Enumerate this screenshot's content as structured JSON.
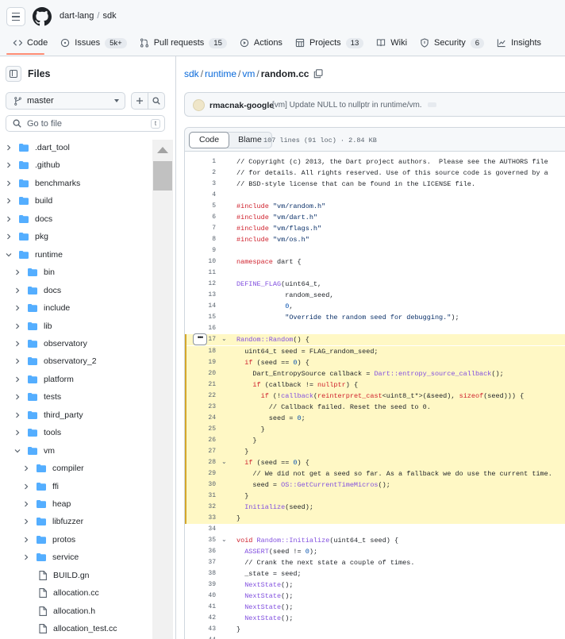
{
  "header": {
    "owner": "dart-lang",
    "separator": "/",
    "repo": "sdk",
    "tabs": [
      {
        "label": "Code",
        "count": "",
        "icon": "code-icon"
      },
      {
        "label": "Issues",
        "count": "5k+",
        "icon": "issue-icon"
      },
      {
        "label": "Pull requests",
        "count": "15",
        "icon": "pull-request-icon"
      },
      {
        "label": "Actions",
        "count": "",
        "icon": "play-icon"
      },
      {
        "label": "Projects",
        "count": "13",
        "icon": "table-icon"
      },
      {
        "label": "Wiki",
        "count": "",
        "icon": "book-icon"
      },
      {
        "label": "Security",
        "count": "6",
        "icon": "shield-icon"
      },
      {
        "label": "Insights",
        "count": "",
        "icon": "graph-icon"
      }
    ]
  },
  "sidebar": {
    "title": "Files",
    "branch": "master",
    "search_placeholder": "Go to file",
    "search_shortcut": "t",
    "tree": [
      {
        "name": ".dart_tool",
        "type": "dir",
        "depth": 0,
        "open": false
      },
      {
        "name": ".github",
        "type": "dir",
        "depth": 0,
        "open": false
      },
      {
        "name": "benchmarks",
        "type": "dir",
        "depth": 0,
        "open": false
      },
      {
        "name": "build",
        "type": "dir",
        "depth": 0,
        "open": false
      },
      {
        "name": "docs",
        "type": "dir",
        "depth": 0,
        "open": false
      },
      {
        "name": "pkg",
        "type": "dir",
        "depth": 0,
        "open": false
      },
      {
        "name": "runtime",
        "type": "dir",
        "depth": 0,
        "open": true
      },
      {
        "name": "bin",
        "type": "dir",
        "depth": 1,
        "open": false
      },
      {
        "name": "docs",
        "type": "dir",
        "depth": 1,
        "open": false
      },
      {
        "name": "include",
        "type": "dir",
        "depth": 1,
        "open": false
      },
      {
        "name": "lib",
        "type": "dir",
        "depth": 1,
        "open": false
      },
      {
        "name": "observatory",
        "type": "dir",
        "depth": 1,
        "open": false
      },
      {
        "name": "observatory_2",
        "type": "dir",
        "depth": 1,
        "open": false
      },
      {
        "name": "platform",
        "type": "dir",
        "depth": 1,
        "open": false
      },
      {
        "name": "tests",
        "type": "dir",
        "depth": 1,
        "open": false
      },
      {
        "name": "third_party",
        "type": "dir",
        "depth": 1,
        "open": false
      },
      {
        "name": "tools",
        "type": "dir",
        "depth": 1,
        "open": false
      },
      {
        "name": "vm",
        "type": "dir",
        "depth": 1,
        "open": true
      },
      {
        "name": "compiler",
        "type": "dir",
        "depth": 2,
        "open": false
      },
      {
        "name": "ffi",
        "type": "dir",
        "depth": 2,
        "open": false
      },
      {
        "name": "heap",
        "type": "dir",
        "depth": 2,
        "open": false
      },
      {
        "name": "libfuzzer",
        "type": "dir",
        "depth": 2,
        "open": false
      },
      {
        "name": "protos",
        "type": "dir",
        "depth": 2,
        "open": false
      },
      {
        "name": "service",
        "type": "dir",
        "depth": 2,
        "open": false
      },
      {
        "name": "BUILD.gn",
        "type": "file",
        "depth": 2,
        "open": false
      },
      {
        "name": "allocation.cc",
        "type": "file",
        "depth": 2,
        "open": false
      },
      {
        "name": "allocation.h",
        "type": "file",
        "depth": 2,
        "open": false
      },
      {
        "name": "allocation_test.cc",
        "type": "file",
        "depth": 2,
        "open": false
      }
    ]
  },
  "path": {
    "parts": [
      "sdk",
      "runtime",
      "vm"
    ],
    "separator": "/",
    "file": "random.cc"
  },
  "commit": {
    "author": "rmacnak-google",
    "message": "[vm] Update NULL to nullptr in runtime/vm."
  },
  "code": {
    "tabs": [
      "Code",
      "Blame"
    ],
    "meta": "107 lines (91 loc) · 2.84 KB",
    "lines": [
      {
        "n": "1",
        "t": "// Copyright (c) 2013, the Dart project authors.  Please see the AUTHORS file",
        "c": "cm"
      },
      {
        "n": "2",
        "t": "// for details. All rights reserved. Use of this source code is governed by a",
        "c": "cm"
      },
      {
        "n": "3",
        "t": "// BSD-style license that can be found in the LICENSE file.",
        "c": "cm"
      },
      {
        "n": "4",
        "t": ""
      },
      {
        "n": "5",
        "t": "#include \"vm/random.h\"",
        "c": "inc"
      },
      {
        "n": "6",
        "t": "#include \"vm/dart.h\"",
        "c": "inc"
      },
      {
        "n": "7",
        "t": "#include \"vm/flags.h\"",
        "c": "inc"
      },
      {
        "n": "8",
        "t": "#include \"vm/os.h\"",
        "c": "inc"
      },
      {
        "n": "9",
        "t": ""
      },
      {
        "n": "10",
        "t": "namespace dart {",
        "c": "ns"
      },
      {
        "n": "11",
        "t": ""
      },
      {
        "n": "12",
        "t": "DEFINE_FLAG(uint64_t,",
        "c": "fn"
      },
      {
        "n": "13",
        "t": "            random_seed,"
      },
      {
        "n": "14",
        "t": "            0,",
        "c": "nm"
      },
      {
        "n": "15",
        "t": "            \"Override the random seed for debugging.\");",
        "c": "st"
      },
      {
        "n": "16",
        "t": ""
      },
      {
        "n": "17",
        "t": "Random::Random() {",
        "c": "fn",
        "hl": true,
        "fold": true
      },
      {
        "n": "18",
        "t": "  uint64_t seed = FLAG_random_seed;",
        "hl": true
      },
      {
        "n": "19",
        "t": "  if (seed == 0) {",
        "c": "kw",
        "hl": true
      },
      {
        "n": "20",
        "t": "    Dart_EntropySource callback = Dart::entropy_source_callback();",
        "hl": true
      },
      {
        "n": "21",
        "t": "    if (callback != nullptr) {",
        "c": "kw",
        "hl": true
      },
      {
        "n": "22",
        "t": "      if (!callback(reinterpret_cast<uint8_t*>(&seed), sizeof(seed))) {",
        "c": "kw",
        "hl": true
      },
      {
        "n": "23",
        "t": "        // Callback failed. Reset the seed to 0.",
        "c": "cm",
        "hl": true
      },
      {
        "n": "24",
        "t": "        seed = 0;",
        "hl": true
      },
      {
        "n": "25",
        "t": "      }",
        "hl": true
      },
      {
        "n": "26",
        "t": "    }",
        "hl": true
      },
      {
        "n": "27",
        "t": "  }",
        "hl": true
      },
      {
        "n": "28",
        "t": "  if (seed == 0) {",
        "c": "kw",
        "hl": true,
        "fold": true
      },
      {
        "n": "29",
        "t": "    // We did not get a seed so far. As a fallback we do use the current time.",
        "c": "cm",
        "hl": true
      },
      {
        "n": "30",
        "t": "    seed = OS::GetCurrentTimeMicros();",
        "hl": true
      },
      {
        "n": "31",
        "t": "  }",
        "hl": true
      },
      {
        "n": "32",
        "t": "  Initialize(seed);",
        "c": "fn",
        "hl": true
      },
      {
        "n": "33",
        "t": "}",
        "hl": true
      },
      {
        "n": "34",
        "t": ""
      },
      {
        "n": "35",
        "t": "void Random::Initialize(uint64_t seed) {",
        "c": "fn",
        "fold": true
      },
      {
        "n": "36",
        "t": "  ASSERT(seed != 0);",
        "c": "fn"
      },
      {
        "n": "37",
        "t": "  // Crank the next state a couple of times.",
        "c": "cm"
      },
      {
        "n": "38",
        "t": "  _state = seed;"
      },
      {
        "n": "39",
        "t": "  NextState();",
        "c": "fn"
      },
      {
        "n": "40",
        "t": "  NextState();",
        "c": "fn"
      },
      {
        "n": "41",
        "t": "  NextState();",
        "c": "fn"
      },
      {
        "n": "42",
        "t": "  NextState();",
        "c": "fn"
      },
      {
        "n": "43",
        "t": "}"
      },
      {
        "n": "44",
        "t": ""
      }
    ]
  },
  "colors": {
    "tab_underline": "#fd8c73",
    "link": "#0969da",
    "highlight": "#fff8c5",
    "folder": "#54aeff"
  }
}
